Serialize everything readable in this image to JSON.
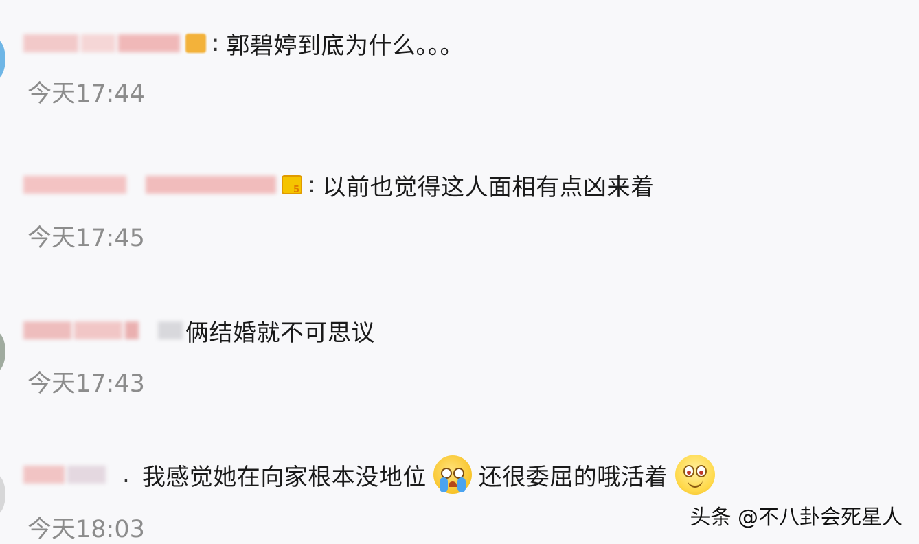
{
  "comments": [
    {
      "separator": ":",
      "text": "郭碧婷到底为什么。。。",
      "time": "今天17:44"
    },
    {
      "separator": ":",
      "text": "以前也觉得这人面相有点凶来着",
      "time": "今天17:45"
    },
    {
      "separator": "",
      "text": "俩结婚就不可思议",
      "time": "今天17:43"
    },
    {
      "separator": ".",
      "text_part1": "我感觉她在向家根本没地位",
      "emoji1": "crying-face-icon",
      "text_part2": "还很委屈的哦活着",
      "emoji2": "smiling-face-icon",
      "time": "今天18:03"
    }
  ],
  "watermark": "头条 @不八卦会死星人",
  "colors": {
    "background": "#f8f8fa",
    "text": "#1a1a1a",
    "timestamp": "#8c8c8c"
  }
}
